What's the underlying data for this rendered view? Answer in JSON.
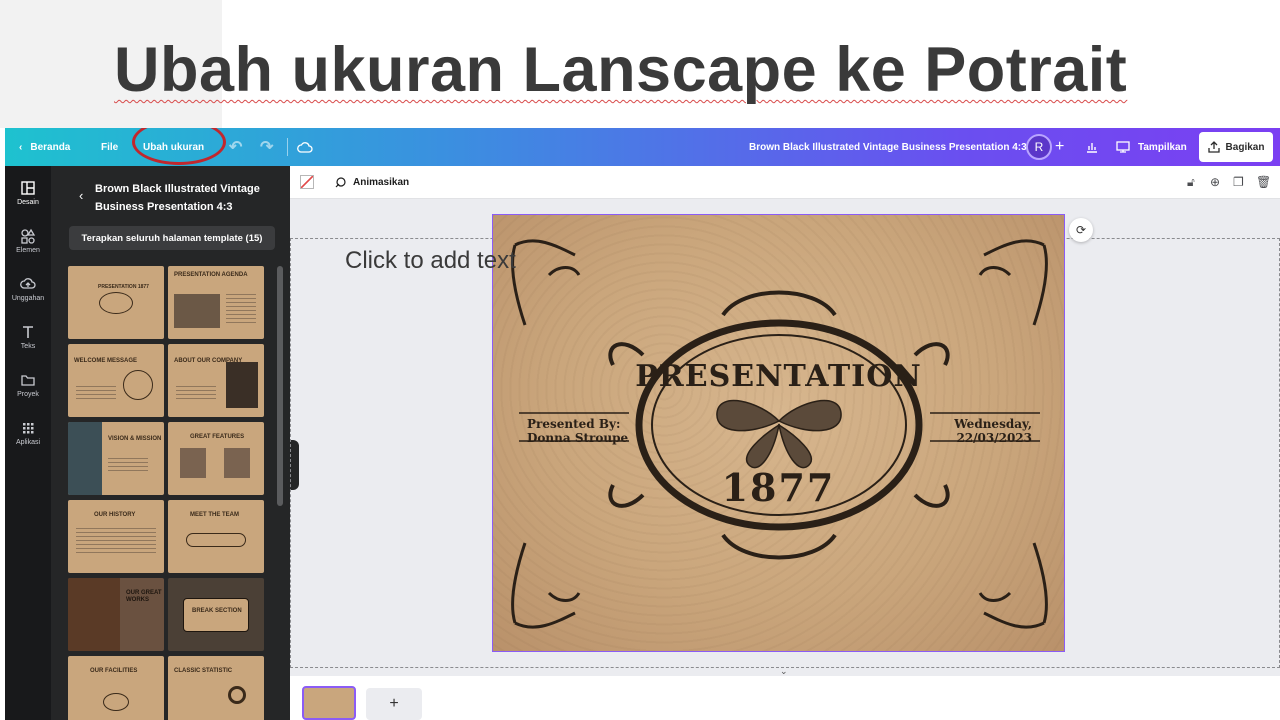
{
  "headline": "Ubah ukuran Lanscape ke Potrait",
  "topbar": {
    "home_label": "Beranda",
    "file_label": "File",
    "resize_label": "Ubah ukuran",
    "doc_title": "Brown Black Illustrated Vintage Business Presentation 4:3",
    "avatar_initial": "R",
    "present_label": "Tampilkan",
    "share_label": "Bagikan"
  },
  "rail": {
    "items": [
      {
        "label": "Desain",
        "icon": "layout-icon"
      },
      {
        "label": "Elemen",
        "icon": "shapes-icon"
      },
      {
        "label": "Unggahan",
        "icon": "upload-icon"
      },
      {
        "label": "Teks",
        "icon": "text-icon"
      },
      {
        "label": "Proyek",
        "icon": "folder-icon"
      },
      {
        "label": "Aplikasi",
        "icon": "apps-icon"
      }
    ]
  },
  "panel": {
    "title": "Brown Black Illustrated Vintage Business Presentation 4:3",
    "apply_label": "Terapkan seluruh halaman template (15)",
    "thumbs": [
      {
        "title": "Presentation 1877"
      },
      {
        "title": "Presentation Agenda"
      },
      {
        "title": "Welcome Message"
      },
      {
        "title": "About Our Company"
      },
      {
        "title": "Vision & Mission"
      },
      {
        "title": "Great Features"
      },
      {
        "title": "Our History"
      },
      {
        "title": "Meet The Team"
      },
      {
        "title": "Our Great Works"
      },
      {
        "title": "Break Section"
      },
      {
        "title": "Our Facilities"
      },
      {
        "title": "Classic Statistic"
      }
    ]
  },
  "subbar": {
    "animate_label": "Animasikan"
  },
  "canvas": {
    "placeholder": "Click to add text",
    "slide_title": "PRESENTATION",
    "slide_year": "1877",
    "presenter_line1": "Presented By:",
    "presenter_line2": "Donna Stroupe",
    "date_line1": "Wednesday,",
    "date_line2": "22/03/2023"
  },
  "pages": {
    "add_label": "+"
  },
  "colors": {
    "accent": "#8b5cf6",
    "highlight_circle": "#c1272d",
    "panel_bg": "#252627",
    "rail_bg": "#18191b"
  }
}
